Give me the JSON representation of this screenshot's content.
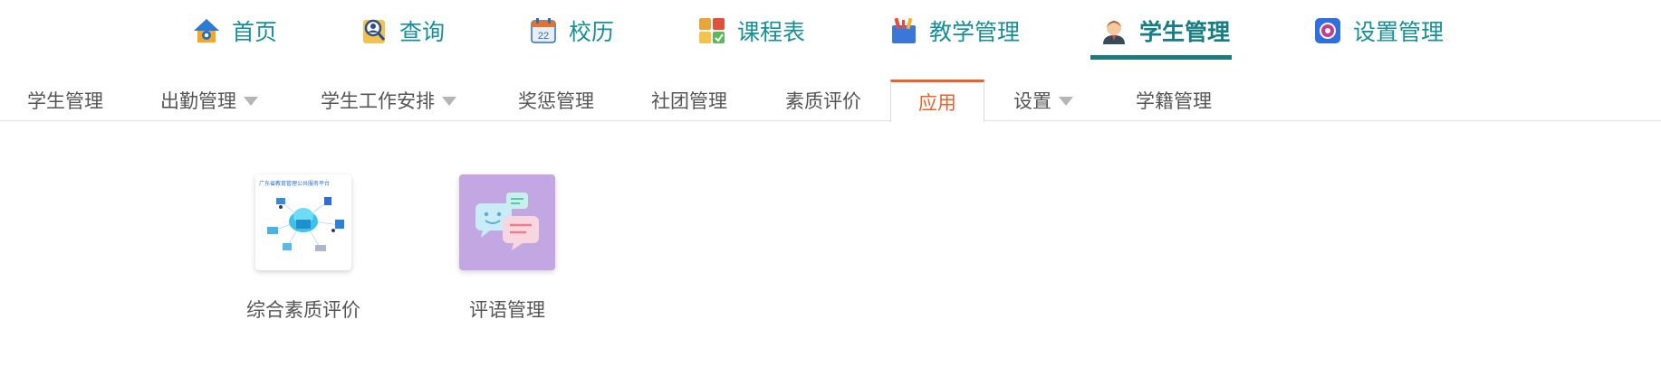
{
  "top_nav": {
    "items": [
      {
        "label": "首页",
        "icon": "home-icon"
      },
      {
        "label": "查询",
        "icon": "search-person-icon"
      },
      {
        "label": "校历",
        "icon": "calendar-icon"
      },
      {
        "label": "课程表",
        "icon": "schedule-icon"
      },
      {
        "label": "教学管理",
        "icon": "teaching-icon"
      },
      {
        "label": "学生管理",
        "icon": "student-icon",
        "active": true
      },
      {
        "label": "设置管理",
        "icon": "settings-icon"
      }
    ]
  },
  "sub_nav": {
    "items": [
      {
        "label": "学生管理"
      },
      {
        "label": "出勤管理",
        "dropdown": true
      },
      {
        "label": "学生工作安排",
        "dropdown": true
      },
      {
        "label": "奖惩管理"
      },
      {
        "label": "社团管理"
      },
      {
        "label": "素质评价"
      },
      {
        "label": "应用",
        "active": true
      },
      {
        "label": "设置",
        "dropdown": true
      },
      {
        "label": "学籍管理"
      }
    ]
  },
  "apps": [
    {
      "label": "综合素质评价",
      "thumb_title": "广东省教育管理公共服务平台"
    },
    {
      "label": "评语管理"
    }
  ],
  "colors": {
    "nav_text": "#178f96",
    "nav_active_underline": "#1a7c80",
    "subnav_active": "#e8632c",
    "comment_tile_bg": "#c3a7e3"
  }
}
